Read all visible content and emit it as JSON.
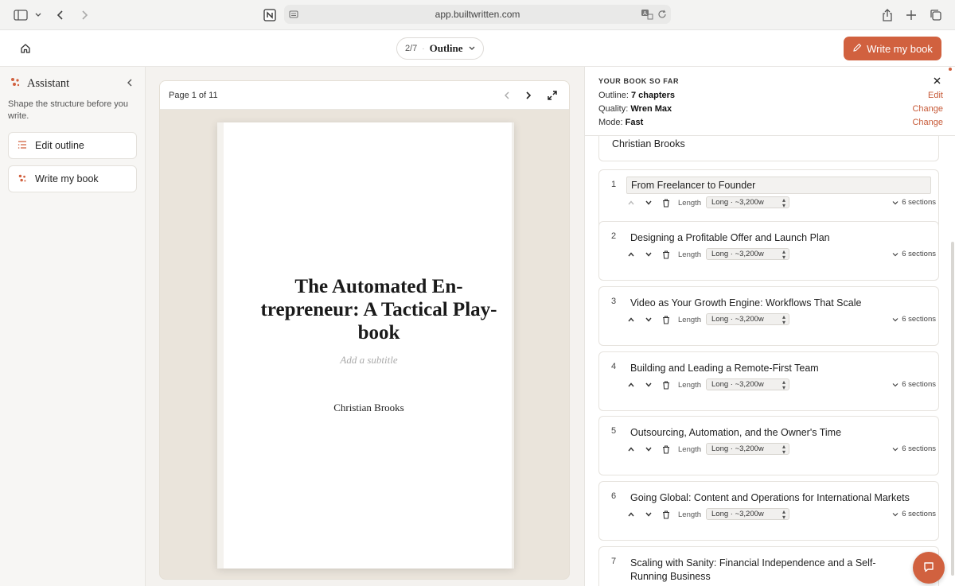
{
  "browser": {
    "url": "app.builtwritten.com"
  },
  "header": {
    "step_count": "2/7",
    "step_separator": "·",
    "step_name": "Outline",
    "write_button": "Write my book"
  },
  "sidebar": {
    "title": "Assistant",
    "description": "Shape the structure before you write.",
    "buttons": [
      {
        "label": "Edit outline"
      },
      {
        "label": "Write my book"
      }
    ]
  },
  "preview": {
    "page_indicator": "Page 1 of 11",
    "title_lines": [
      "The Automated En-",
      "trepreneur: A Tactical Play-",
      "book"
    ],
    "subtitle_placeholder": "Add a subtitle",
    "author": "Christian Brooks"
  },
  "summary": {
    "heading": "YOUR BOOK SO FAR",
    "rows": [
      {
        "label": "Outline:",
        "value": "7 chapters",
        "action": "Edit"
      },
      {
        "label": "Quality:",
        "value": "Wren Max",
        "action": "Change"
      },
      {
        "label": "Mode:",
        "value": "Fast",
        "action": "Change"
      }
    ]
  },
  "author_field": "Christian Brooks",
  "chapter_controls": {
    "length_label": "Length",
    "length_value": "Long · ~3,200w",
    "sections": "6 sections"
  },
  "chapters": [
    {
      "num": "1",
      "title": "From Freelancer to Founder"
    },
    {
      "num": "2",
      "title": "Designing a Profitable Offer and Launch Plan"
    },
    {
      "num": "3",
      "title": "Video as Your Growth Engine: Workflows That Scale"
    },
    {
      "num": "4",
      "title": "Building and Leading a Remote-First Team"
    },
    {
      "num": "5",
      "title": "Outsourcing, Automation, and the Owner's Time"
    },
    {
      "num": "6",
      "title": "Going Global: Content and Operations for International Markets"
    },
    {
      "num": "7",
      "title": "Scaling with Sanity: Financial Independence and a Self-Running Business"
    }
  ],
  "colors": {
    "accent": "#d1613f",
    "accent_text": "#c75a38"
  }
}
